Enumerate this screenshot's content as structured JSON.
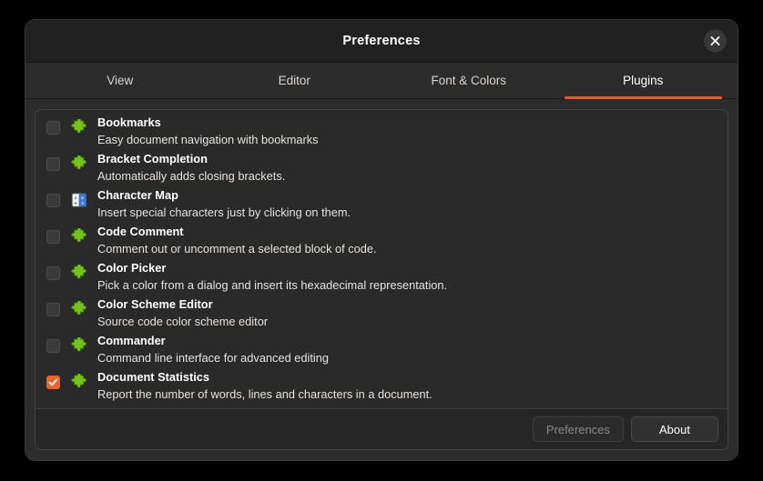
{
  "window": {
    "title": "Preferences",
    "close_icon": "close-icon"
  },
  "tabs": [
    {
      "label": "View",
      "active": false
    },
    {
      "label": "Editor",
      "active": false
    },
    {
      "label": "Font & Colors",
      "active": false
    },
    {
      "label": "Plugins",
      "active": true
    }
  ],
  "colors": {
    "accent": "#e25b2a",
    "checkbox_checked": "#e8642a",
    "plugin_icon_green": "#72c41b",
    "plugin_icon_blue": "#3a7bd5",
    "window_bg": "#2c2c2c",
    "titlebar_bg": "#212121"
  },
  "plugins": [
    {
      "name": "Bookmarks",
      "description": "Easy document navigation with bookmarks",
      "checked": false,
      "icon": "puzzle-piece-icon"
    },
    {
      "name": "Bracket Completion",
      "description": "Automatically adds closing brackets.",
      "checked": false,
      "icon": "puzzle-piece-icon"
    },
    {
      "name": "Character Map",
      "description": "Insert special characters just by clicking on them.",
      "checked": false,
      "icon": "character-map-icon"
    },
    {
      "name": "Code Comment",
      "description": "Comment out or uncomment a selected block of code.",
      "checked": false,
      "icon": "puzzle-piece-icon"
    },
    {
      "name": "Color Picker",
      "description": "Pick a color from a dialog and insert its hexadecimal representation.",
      "checked": false,
      "icon": "puzzle-piece-icon"
    },
    {
      "name": "Color Scheme Editor",
      "description": "Source code color scheme editor",
      "checked": false,
      "icon": "puzzle-piece-icon"
    },
    {
      "name": "Commander",
      "description": "Command line interface for advanced editing",
      "checked": false,
      "icon": "puzzle-piece-icon"
    },
    {
      "name": "Document Statistics",
      "description": "Report the number of words, lines and characters in a document.",
      "checked": true,
      "icon": "puzzle-piece-icon"
    }
  ],
  "buttons": {
    "preferences": {
      "label": "Preferences",
      "enabled": false
    },
    "about": {
      "label": "About",
      "enabled": true
    }
  }
}
